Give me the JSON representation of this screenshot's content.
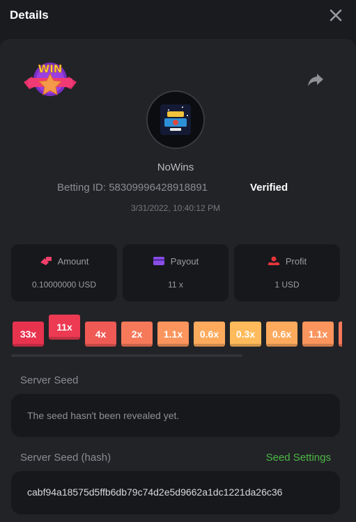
{
  "header": {
    "title": "Details"
  },
  "bet": {
    "username": "NoWins",
    "betting_id_label": "Betting ID: 58309996428918891",
    "verified_label": "Verified",
    "date": "3/31/2022, 10:40:12 PM",
    "badge_text": "WIN"
  },
  "stats": {
    "amount_label": "Amount",
    "amount_value": "0.10000000 USD",
    "payout_label": "Payout",
    "payout_value": "11 x",
    "profit_label": "Profit",
    "profit_value": "1 USD"
  },
  "multipliers": [
    {
      "label": "33x",
      "color": "#e8334f",
      "selected": false
    },
    {
      "label": "11x",
      "color": "#ec3a52",
      "selected": true
    },
    {
      "label": "4x",
      "color": "#f05a55",
      "selected": false
    },
    {
      "label": "2x",
      "color": "#f6795a",
      "selected": false
    },
    {
      "label": "1.1x",
      "color": "#fb955d",
      "selected": false
    },
    {
      "label": "0.6x",
      "color": "#fdaa5d",
      "selected": false
    },
    {
      "label": "0.3x",
      "color": "#ffbb5b",
      "selected": false
    },
    {
      "label": "0.6x",
      "color": "#fdaa5d",
      "selected": false
    },
    {
      "label": "1.1x",
      "color": "#fb955d",
      "selected": false
    },
    {
      "label": "",
      "color": "#f6795a",
      "selected": false
    }
  ],
  "server_seed": {
    "label": "Server Seed",
    "value": "The seed hasn't been revealed yet."
  },
  "server_seed_hash": {
    "label": "Server Seed (hash)",
    "settings_link": "Seed Settings",
    "value": "cabf94a18575d5ffb6db79c74d2e5d9662a1dc1221da26c36"
  }
}
